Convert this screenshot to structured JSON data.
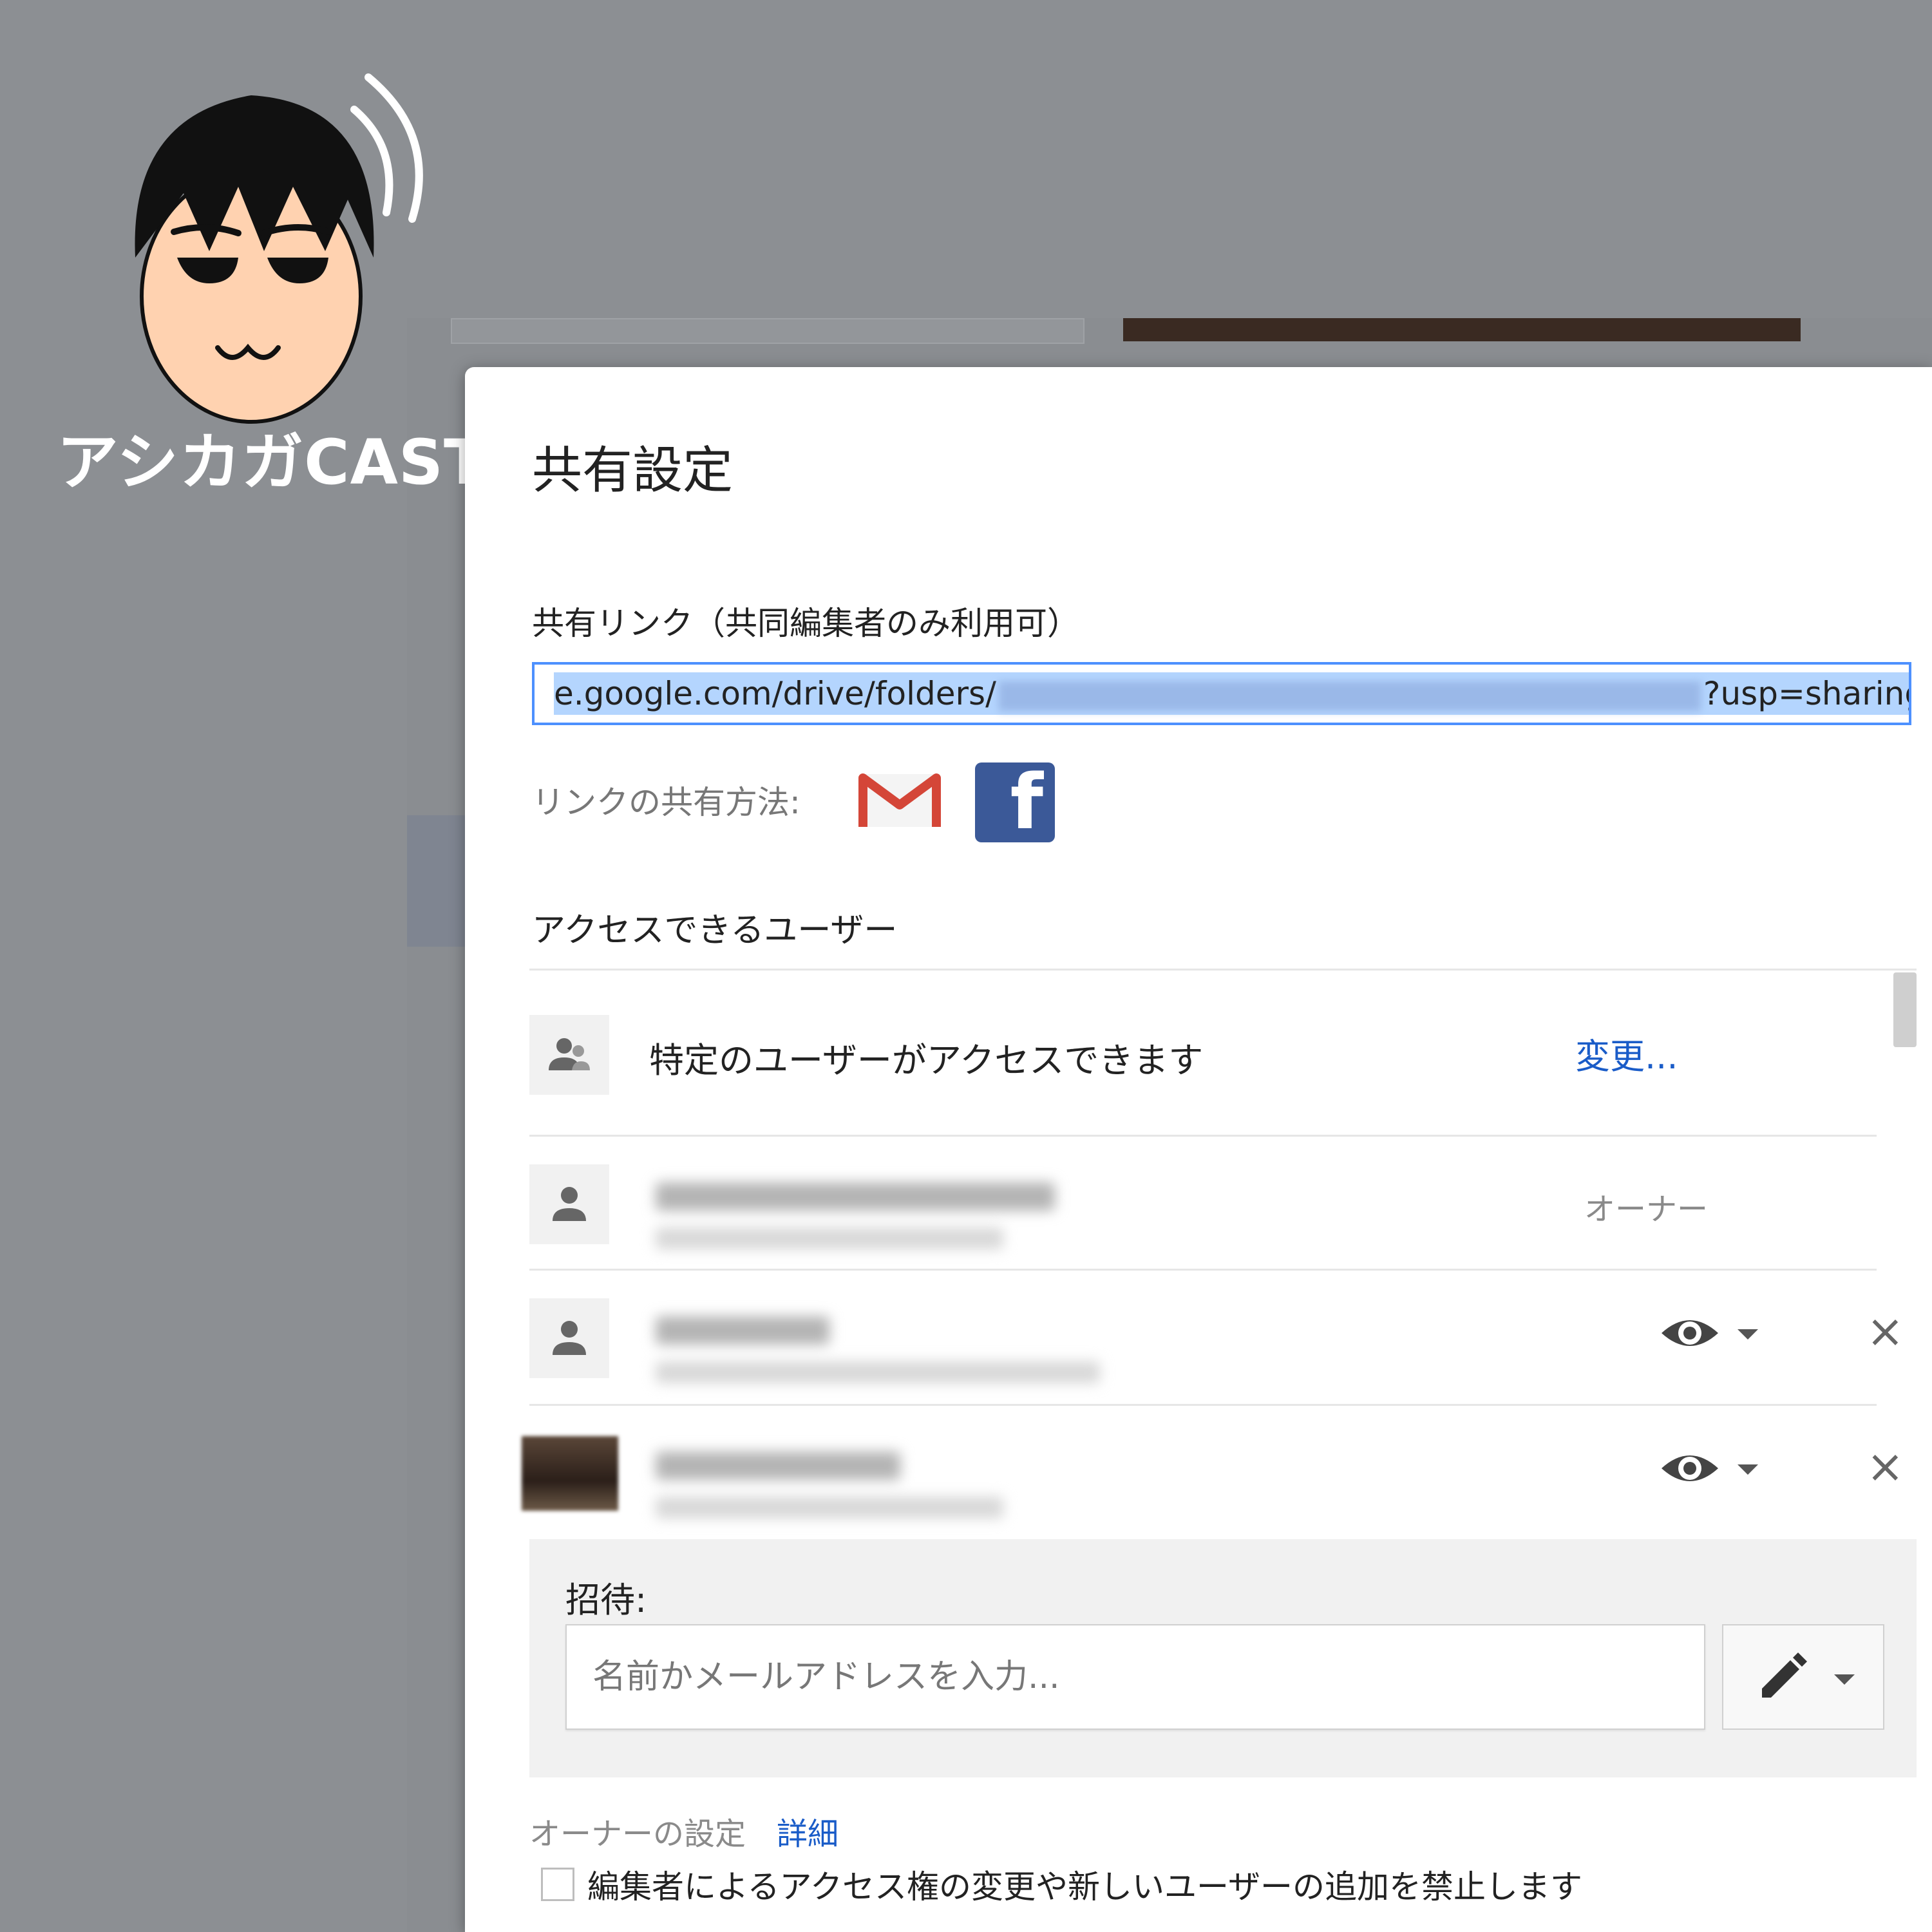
{
  "brand": {
    "name": "アシカガCAST"
  },
  "dialog": {
    "title": "共有設定",
    "share_link_label": "共有リンク（共同編集者のみ利用可）",
    "link_prefix": "e.google.com/drive/folders/",
    "link_suffix": "?usp=sharing",
    "share_methods_label": "リンクの共有方法:",
    "share_methods": [
      "gmail-icon",
      "facebook-icon"
    ],
    "access_label": "アクセスできるユーザー",
    "visibility": {
      "text": "特定のユーザーがアクセスできます",
      "change_link": "変更..."
    },
    "users": [
      {
        "role_label": "オーナー"
      },
      {
        "permission_icon": "eye-icon"
      },
      {
        "permission_icon": "eye-icon"
      }
    ],
    "invite": {
      "label": "招待:",
      "placeholder": "名前かメールアドレスを入力...",
      "permission_icon": "pencil-icon"
    },
    "owner_settings": {
      "label": "オーナーの設定",
      "details_link": "詳細",
      "checkbox_label": "編集者によるアクセス権の変更や新しいユーザーの追加を禁止します",
      "checked": false
    }
  },
  "colors": {
    "link_blue": "#1a5cc8",
    "focus_blue": "#4d90fe",
    "facebook": "#3b5998",
    "gmail_red": "#d44638"
  }
}
